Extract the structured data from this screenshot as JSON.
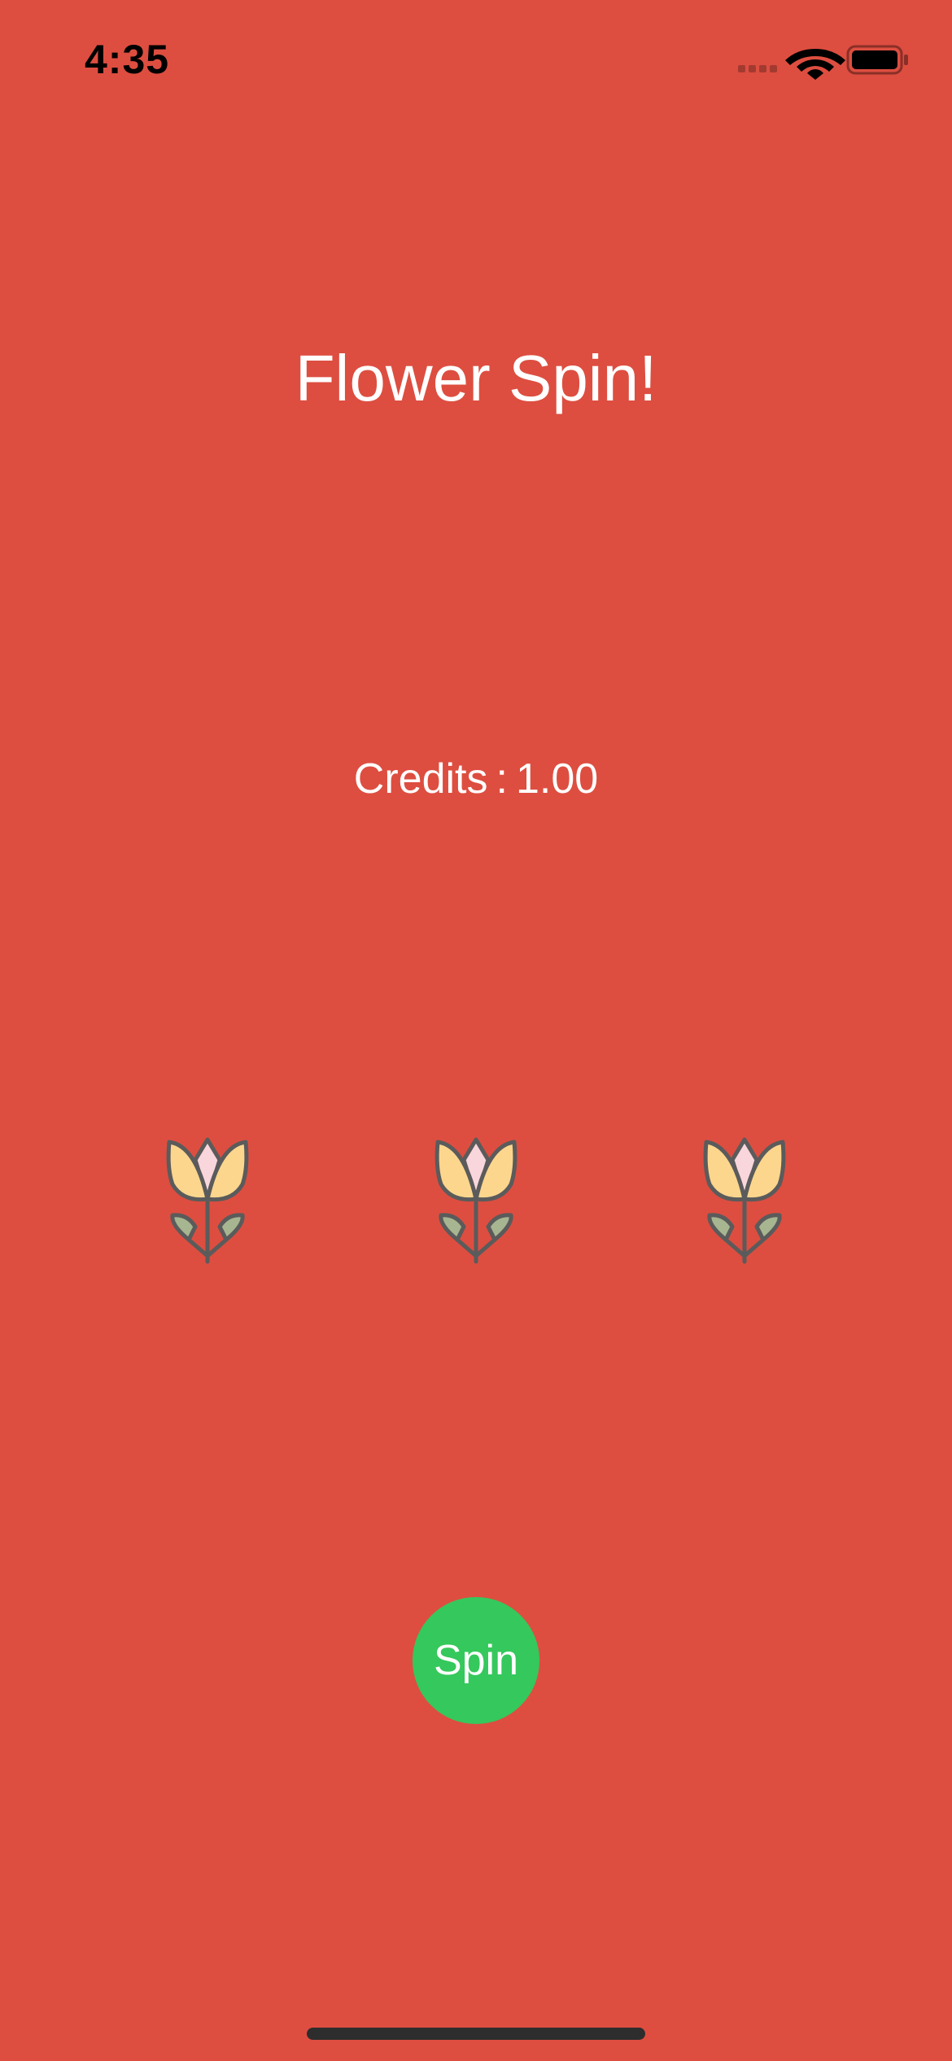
{
  "status_bar": {
    "time": "4:35",
    "icons": [
      "cellular-signal-icon",
      "wifi-icon",
      "battery-icon"
    ]
  },
  "app": {
    "title": "Flower Spin!",
    "credits_label": "Credits",
    "credits_separator": ":",
    "credits_value": "1.00",
    "slots": [
      "tulip-icon",
      "tulip-icon",
      "tulip-icon"
    ],
    "spin_label": "Spin"
  },
  "colors": {
    "background": "#dd4e40",
    "spin_button": "#35c85c",
    "text": "#ffffff",
    "tulip_petal": "#fcd68d",
    "tulip_bud": "#f9d6dc",
    "tulip_leaf": "#a7b590",
    "tulip_outline": "#5b5b5b"
  }
}
